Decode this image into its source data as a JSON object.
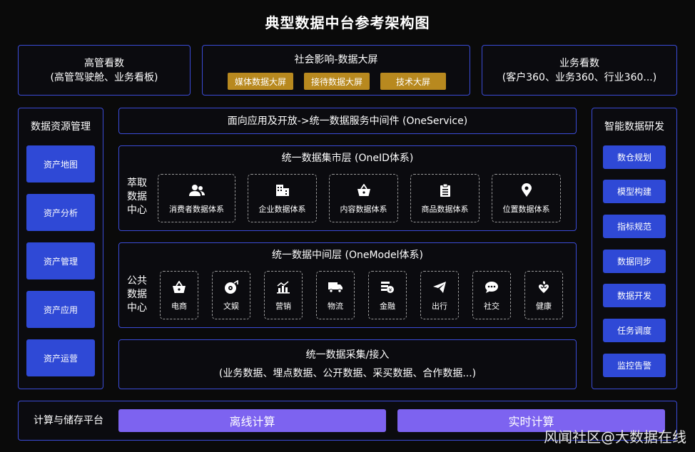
{
  "title": "典型数据中台参考架构图",
  "top": {
    "left": {
      "title": "高管看数",
      "subtitle": "(高管驾驶舱、业务看板)"
    },
    "middle": {
      "title": "社会影响-数据大屏",
      "tags": [
        "媒体数据大屏",
        "接待数据大屏",
        "技术大屏"
      ]
    },
    "right": {
      "title": "业务看数",
      "subtitle": "(客户360、业务360、行业360...)"
    }
  },
  "left_panel": {
    "title": "数据资源管理",
    "items": [
      "资产地图",
      "资产分析",
      "资产管理",
      "资产应用",
      "资产运营"
    ]
  },
  "right_panel": {
    "title": "智能数据研发",
    "items": [
      "数仓规划",
      "模型构建",
      "指标规范",
      "数据同步",
      "数据开发",
      "任务调度",
      "监控告警"
    ]
  },
  "oneservice": "面向应用及开放->统一数据服务中间件 (OneService)",
  "oneid": {
    "title": "统一数据集市层 (OneID体系)",
    "side_label": "萃取数据中心",
    "cards": [
      {
        "label": "消费者数据体系",
        "icon": "users-icon"
      },
      {
        "label": "企业数据体系",
        "icon": "building-icon"
      },
      {
        "label": "内容数据体系",
        "icon": "basket-icon"
      },
      {
        "label": "商品数据体系",
        "icon": "clipboard-icon"
      },
      {
        "label": "位置数据体系",
        "icon": "location-pin-icon"
      }
    ]
  },
  "onemodel": {
    "title": "统一数据中间层 (OneModel体系)",
    "side_label": "公共数据中心",
    "cards": [
      {
        "label": "电商",
        "icon": "shopping-basket-icon"
      },
      {
        "label": "文娱",
        "icon": "entertainment-icon"
      },
      {
        "label": "营销",
        "icon": "marketing-chart-icon"
      },
      {
        "label": "物流",
        "icon": "truck-icon"
      },
      {
        "label": "金融",
        "icon": "finance-icon"
      },
      {
        "label": "出行",
        "icon": "paper-plane-icon"
      },
      {
        "label": "社交",
        "icon": "chat-bubble-icon"
      },
      {
        "label": "健康",
        "icon": "health-icon"
      }
    ]
  },
  "collect": {
    "title": "统一数据采集/接入",
    "subtitle": "(业务数据、埋点数据、公开数据、采买数据、合作数据...)"
  },
  "bottom": {
    "label": "计算与储存平台",
    "offline": "离线计算",
    "realtime": "实时计算"
  },
  "watermark": "风闻社区@大数据在线",
  "colors": {
    "border": "#3b4bd6",
    "gold": "#b8891f",
    "blue": "#2f49d6",
    "purple": "#7d63f0"
  }
}
